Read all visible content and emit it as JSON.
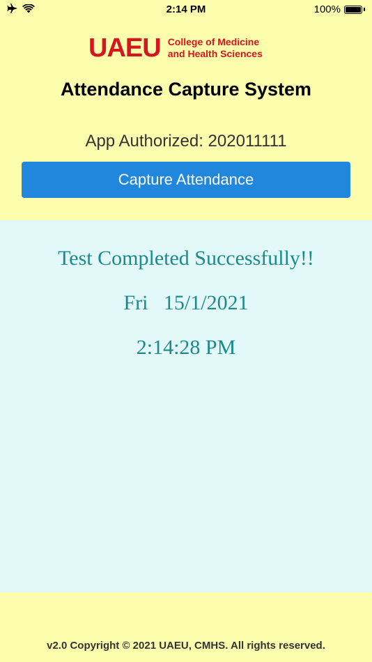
{
  "status_bar": {
    "time": "2:14 PM",
    "battery_percent": "100%",
    "battery_level": 1.0,
    "icons": [
      "airplane-icon",
      "wifi-icon",
      "battery-icon"
    ]
  },
  "logo": {
    "mark": "UAEU",
    "line1": "College of Medicine",
    "line2": "and Health Sciences",
    "color": "#d4161f"
  },
  "header": {
    "title": "Attendance Capture System",
    "authorized_text": "App Authorized: 202011111"
  },
  "actions": {
    "capture_label": "Capture Attendance",
    "button_color": "#2187dc"
  },
  "result": {
    "message": "Test Completed Successfully!!",
    "date": "Fri   15/1/2021",
    "time": "2:14:28 PM",
    "text_color": "#1a8a8d",
    "panel_color": "#e3f8f8"
  },
  "footer": {
    "copyright": "v2.0 Copyright © 2021 UAEU, CMHS. All rights reserved."
  },
  "theme": {
    "background": "#fdfdae"
  }
}
